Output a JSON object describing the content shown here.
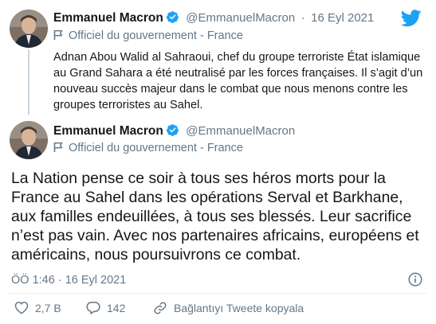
{
  "quoted_tweet": {
    "author_name": "Emmanuel Macron",
    "handle": "@EmmanuelMacron",
    "separator": "·",
    "date": "16 Eyl 2021",
    "official_label": "Officiel du gouvernement - France",
    "text": "Adnan Abou Walid al Sahraoui, chef du groupe terroriste État islamique au Grand Sahara a été neutralisé par les forces françaises. Il s’agit d’un nouveau succès majeur dans le combat que nous menons contre les groupes terroristes au Sahel."
  },
  "main_tweet": {
    "author_name": "Emmanuel Macron",
    "handle": "@EmmanuelMacron",
    "official_label": "Officiel du gouvernement - France",
    "text": "La Nation pense ce soir à tous ses héros morts pour la France au Sahel dans les opérations Serval et Barkhane, aux familles endeuillées, à tous ses blessés. Leur sacrifice n’est pas vain. Avec nos partenaires africains, européens et américains, nous poursuivrons ce combat.",
    "timestamp": "ÖÖ 1:46 · 16 Eyl 2021"
  },
  "actions": {
    "likes": "2,7 B",
    "replies": "142",
    "copy_link": "Bağlantıyı Tweete kopyala"
  },
  "icons": {
    "brand": "twitter-bird-icon",
    "verified": "verified-badge-icon",
    "government": "flag-icon",
    "info": "info-icon",
    "like": "heart-icon",
    "reply": "reply-icon",
    "link": "link-icon"
  },
  "colors": {
    "twitter_blue": "#1da1f2",
    "text": "#14171a",
    "secondary": "#657786"
  }
}
